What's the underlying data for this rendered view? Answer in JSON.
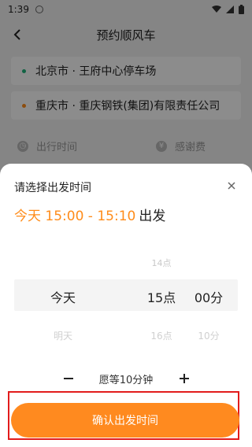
{
  "status_bar": {
    "time": "1:39"
  },
  "header": {
    "title": "预约顺风车"
  },
  "addresses": [
    {
      "text": "北京市 · 王府中心停车场",
      "dot_color": "#1fb57a"
    },
    {
      "text": "重庆市 · 重庆钢铁(集团)有限责任公司",
      "dot_color": "#ff8c1a"
    }
  ],
  "options": {
    "departure_time_label": "出行时间",
    "thank_fee_label": "感谢费"
  },
  "sheet": {
    "title": "请选择出发时间",
    "selected_range": "今天 15:00 - 15:10",
    "selected_suffix": "出发"
  },
  "picker": {
    "day": {
      "prev": "",
      "current": "今天",
      "next": "明天"
    },
    "hour": {
      "prev": "14点",
      "current": "15点",
      "next": "16点"
    },
    "minute": {
      "prev": "",
      "current": "00分",
      "next": "10分"
    }
  },
  "wait": {
    "text": "愿等10分钟",
    "minus": "−",
    "plus": "+"
  },
  "confirm_button": "确认出发时间",
  "colors": {
    "accent": "#ff8a1f",
    "highlight": "#e21c1c"
  },
  "icons": {
    "back": "chevron-left-icon",
    "close": "close-icon",
    "minus": "minus-icon",
    "plus": "plus-icon"
  }
}
